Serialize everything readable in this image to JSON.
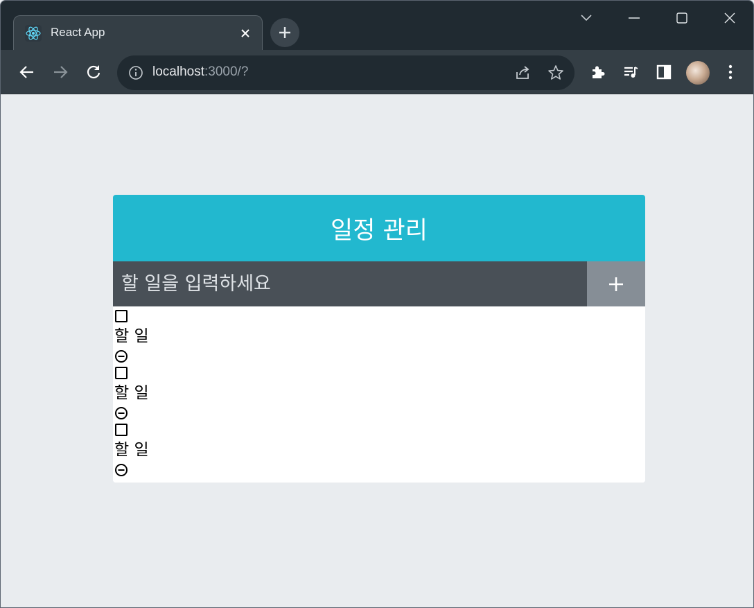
{
  "browser": {
    "tab": {
      "title": "React App",
      "favicon": "react-logo-icon"
    },
    "url": {
      "host": "localhost",
      "rest": ":3000/?"
    },
    "icons": [
      "back-arrow-icon",
      "forward-arrow-icon",
      "reload-icon",
      "info-icon",
      "share-icon",
      "star-icon",
      "extensions-icon",
      "media-control-icon",
      "side-panel-icon",
      "more-icon"
    ]
  },
  "app": {
    "title": "일정 관리",
    "input": {
      "placeholder": "할 일을 입력하세요",
      "value": ""
    },
    "add_button_icon": "plus-icon",
    "todos": [
      {
        "text": "할 일",
        "checked": false
      },
      {
        "text": "할 일",
        "checked": false
      },
      {
        "text": "할 일",
        "checked": false
      }
    ]
  },
  "colors": {
    "header": "#22b8cf",
    "form": "#495057",
    "button": "#868e96",
    "background": "#e9ecef"
  }
}
